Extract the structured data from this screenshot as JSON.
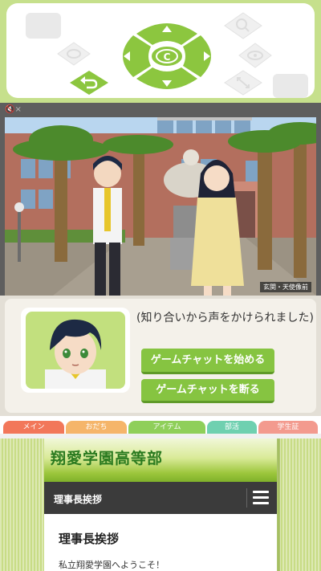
{
  "colors": {
    "controller_bg": "#c6e08c",
    "dpad_green": "#8cc63f",
    "choice_button": "#86c441",
    "portrait_bg": "#c2e07e"
  },
  "controller": {
    "center_button_label": "C",
    "icons": [
      "dpad-up-arrow-icon",
      "dpad-down-arrow-icon",
      "dpad-left-arrow-icon",
      "dpad-right-arrow-icon",
      "back-arrow-icon",
      "search-icon",
      "eye-icon",
      "expand-icon",
      "chevron-down-icon"
    ]
  },
  "status_bar": {
    "mute_label": "🔇×"
  },
  "scene": {
    "location_label": "玄関・天使像前"
  },
  "dialogue": {
    "text": "(知り合いから声をかけられました)",
    "choices": [
      {
        "label": "ゲームチャットを始める"
      },
      {
        "label": "ゲームチャットを断る"
      }
    ]
  },
  "tabs": [
    {
      "label": "メイン",
      "color": "#f2775a"
    },
    {
      "label": "おだち",
      "color": "#f5b56a"
    },
    {
      "label": "アイテム",
      "color": "#8fcf5a"
    },
    {
      "label": "部活",
      "color": "#6fd0b0"
    },
    {
      "label": "学生証",
      "color": "#f39a8e"
    }
  ],
  "website": {
    "site_title": "翔愛学園高等部",
    "nav_title": "理事長挨拶",
    "heading": "理事長挨拶",
    "body_first_line": "私立翔愛学園へようこそ！"
  }
}
